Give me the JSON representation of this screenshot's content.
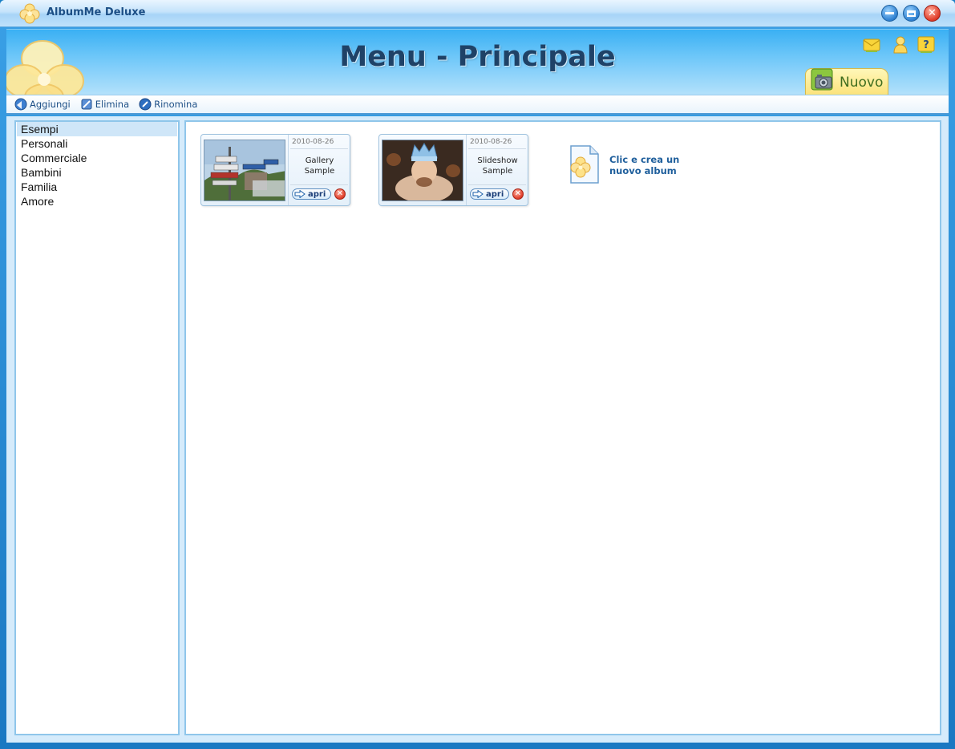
{
  "window": {
    "title": "AlbumMe Deluxe"
  },
  "header": {
    "title": "Menu - Principale",
    "new_tab_label": "Nuovo"
  },
  "toolbar": {
    "items": [
      {
        "label": "Aggiungi",
        "icon": "add-icon"
      },
      {
        "label": "Elimina",
        "icon": "delete-icon"
      },
      {
        "label": "Rinomina",
        "icon": "rename-icon"
      }
    ]
  },
  "sidebar": {
    "categories": [
      "Esempi",
      "Personali",
      "Commerciale",
      "Bambini",
      "Familia",
      "Amore"
    ],
    "selected": "Esempi"
  },
  "albums": [
    {
      "date": "2010-08-26",
      "name_line1": "Gallery",
      "name_line2": "Sample",
      "open_label": "apri"
    },
    {
      "date": "2010-08-26",
      "name_line1": "Slideshow",
      "name_line2": "Sample",
      "open_label": "apri"
    }
  ],
  "new_album": {
    "line1": "Clic e crea un",
    "line2": "nuovo album"
  },
  "colors": {
    "accent": "#1c4f86",
    "title": "#1f4267",
    "selection": "#cfe6f8"
  }
}
